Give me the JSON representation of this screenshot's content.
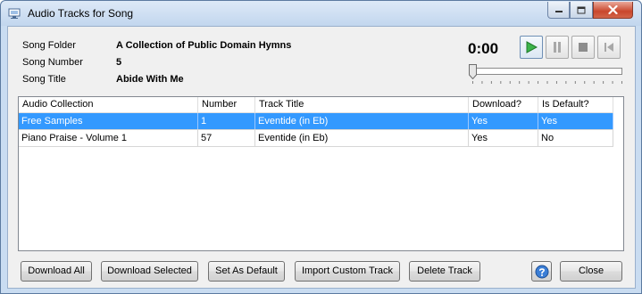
{
  "window": {
    "title": "Audio Tracks for Song"
  },
  "info": {
    "folder_label": "Song Folder",
    "folder_value": "A Collection of Public Domain Hymns",
    "number_label": "Song Number",
    "number_value": "5",
    "title_label": "Song Title",
    "title_value": "Abide With Me"
  },
  "player": {
    "time": "0:00",
    "position_fraction": 0,
    "buttons": [
      "play-icon",
      "pause-icon",
      "stop-icon",
      "rewind-icon"
    ]
  },
  "table": {
    "columns": [
      "Audio Collection",
      "Number",
      "Track Title",
      "Download?",
      "Is Default?"
    ],
    "rows": [
      {
        "collection": "Free Samples",
        "number": "1",
        "track": "Eventide (in Eb)",
        "download": "Yes",
        "is_default": "Yes",
        "selected": true
      },
      {
        "collection": "Piano Praise - Volume 1",
        "number": "57",
        "track": "Eventide (in Eb)",
        "download": "Yes",
        "is_default": "No",
        "selected": false
      }
    ]
  },
  "buttons": {
    "download_all": "Download All",
    "download_selected": "Download Selected",
    "set_default": "Set As Default",
    "import_custom": "Import Custom Track",
    "delete_track": "Delete Track",
    "close": "Close"
  },
  "colors": {
    "selection": "#3399ff",
    "play_icon": "#2ca02c",
    "close_window": "#c9462c"
  }
}
